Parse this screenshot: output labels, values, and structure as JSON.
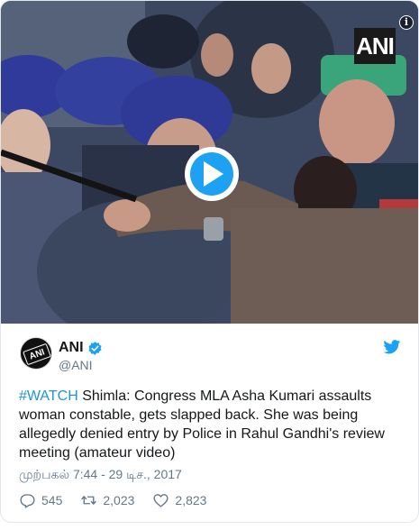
{
  "media": {
    "watermark": "ANI",
    "info_glyph": "i",
    "play_icon": "play-icon"
  },
  "author": {
    "avatar_text": "ANI",
    "display_name": "ANI",
    "verified_icon": "verified-badge-icon",
    "handle": "@ANI"
  },
  "brand_icon": "twitter-bird-icon",
  "tweet": {
    "hashtag": "#WATCH",
    "text": " Shimla: Congress MLA Asha Kumari assaults woman constable, gets slapped back. She was being allegedly denied entry by Police in Rahul Gandhi's review meeting (amateur video)",
    "timestamp": "முற்பகல் 7:44 - 29 டிச., 2017"
  },
  "actions": {
    "replies": "545",
    "retweets": "2,023",
    "likes": "2,823"
  },
  "colors": {
    "accent": "#1da1f2",
    "link": "#1b95e0",
    "muted": "#657786",
    "text": "#14171a"
  }
}
